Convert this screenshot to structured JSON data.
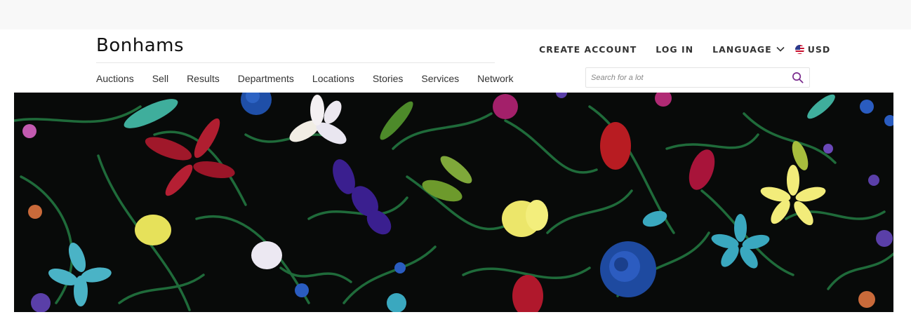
{
  "header": {
    "logo_text": "Bonhams",
    "account_links": {
      "create_account": "CREATE ACCOUNT",
      "log_in": "LOG IN",
      "language": "LANGUAGE",
      "currency": "USD"
    },
    "nav": [
      {
        "label": "Auctions"
      },
      {
        "label": "Sell"
      },
      {
        "label": "Results"
      },
      {
        "label": "Departments"
      },
      {
        "label": "Locations"
      },
      {
        "label": "Stories"
      },
      {
        "label": "Services"
      },
      {
        "label": "Network"
      }
    ],
    "search": {
      "placeholder": "Search for a lot",
      "value": ""
    }
  },
  "hero": {
    "background_color": "#080a09"
  },
  "colors": {
    "accent_purple": "#7b2d8e",
    "text_dark": "#333333"
  },
  "icons": {
    "language_dropdown": "chevron-down-icon",
    "currency_flag": "us-flag-icon",
    "search": "search-icon"
  }
}
